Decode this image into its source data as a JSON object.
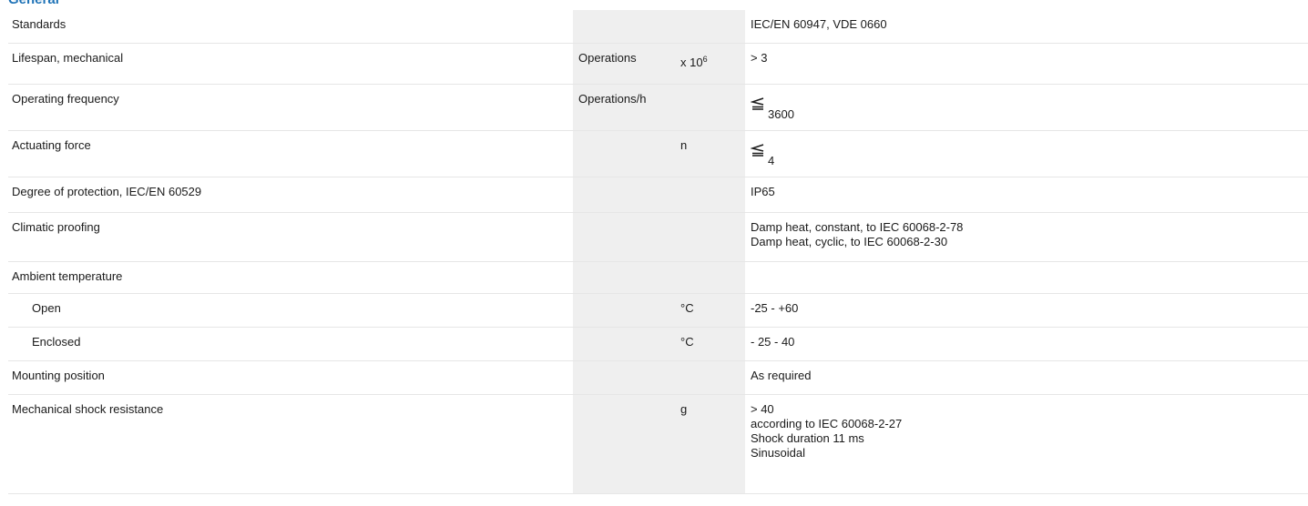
{
  "section": {
    "title": "General"
  },
  "rows": {
    "standards": {
      "label": "Standards",
      "unit1": "",
      "unit2": "",
      "value": "IEC/EN 60947, VDE 0660"
    },
    "lifespan": {
      "label": "Lifespan, mechanical",
      "unit1": "Operations",
      "unit2_prefix": "x 10",
      "unit2_exp": "6",
      "value": "> 3"
    },
    "frequency": {
      "label": "Operating frequency",
      "unit1": "Operations/h",
      "unit2": "",
      "value_icon": "less-than-or-equal-icon",
      "value": "3600"
    },
    "force": {
      "label": "Actuating force",
      "unit1": "",
      "unit2": "n",
      "value_icon": "less-than-or-equal-icon",
      "value": "4"
    },
    "protection": {
      "label": "Degree of protection, IEC/EN 60529",
      "unit1": "",
      "unit2": "",
      "value": "IP65"
    },
    "climatic": {
      "label": "Climatic proofing",
      "unit1": "",
      "unit2": "",
      "value_lines": [
        "Damp heat, constant, to IEC 60068-2-78",
        "Damp heat, cyclic, to IEC 60068-2-30"
      ]
    },
    "ambient": {
      "label": "Ambient temperature",
      "unit1": "",
      "unit2": "",
      "value": ""
    },
    "open": {
      "label": "Open",
      "unit1": "",
      "unit2": "°C",
      "value": "-25 - +60"
    },
    "enclosed": {
      "label": "Enclosed",
      "unit1": "",
      "unit2": "°C",
      "value": "- 25 - 40"
    },
    "mounting": {
      "label": "Mounting position",
      "unit1": "",
      "unit2": "",
      "value": "As required"
    },
    "shock": {
      "label": "Mechanical shock resistance",
      "unit1": "",
      "unit2": "g",
      "value_lines": [
        "> 40",
        "according to IEC 60068-2-27",
        "Shock duration 11 ms",
        "Sinusoidal"
      ]
    }
  }
}
